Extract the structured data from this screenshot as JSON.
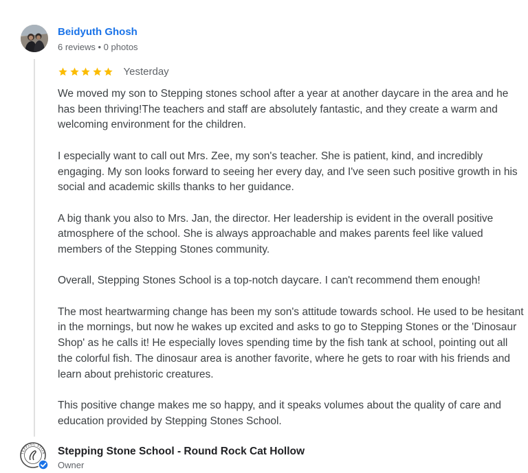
{
  "reviewer": {
    "name": "Beidyuth Ghosh",
    "meta": "6 reviews • 0 photos",
    "avatar_icon": "profile-photo-icon"
  },
  "review": {
    "rating": 5,
    "rating_max": 5,
    "star_color": "#fbbc04",
    "date": "Yesterday",
    "paragraphs": [
      "We moved my son to Stepping stones school after a year at another daycare in the area and he has been thriving!The teachers and staff are absolutely fantastic, and they create a warm and welcoming environment for the children.",
      "I especially want to call out Mrs. Zee, my son's teacher. She is patient, kind, and incredibly engaging. My son looks forward to seeing her every day, and I've seen such positive growth in his social and academic skills thanks to her guidance.",
      "A big thank you also to Mrs. Jan, the director. Her leadership is evident in the overall positive atmosphere of the school. She is always approachable and makes parents feel like valued members of the Stepping Stones community.",
      "Overall, Stepping Stones School is a top-notch daycare. I can't recommend them enough!",
      "The most heartwarming change has been my son's attitude towards school. He used to be hesitant in the mornings, but now he wakes up excited and asks to go to Stepping Stones or the 'Dinosaur Shop' as he calls it! He especially loves spending time by the fish tank at school, pointing out all the colorful fish. The dinosaur area is another favorite, where he gets to roar with his friends and learn about prehistoric creatures.",
      "This positive change makes me so happy, and it speaks volumes about the quality of care and education provided by Stepping Stones School."
    ]
  },
  "owner_reply": {
    "name": "Stepping Stone School - Round Rock Cat Hollow",
    "role": "Owner",
    "logo_text": "STEPPING STONE",
    "verified_icon": "verified-check-icon",
    "verified_color": "#1a73e8"
  },
  "colors": {
    "reviewer_name": "#1a73e8",
    "body_text": "#3c4043",
    "secondary_text": "#5f6368",
    "thread_line": "#e0e0e0"
  }
}
